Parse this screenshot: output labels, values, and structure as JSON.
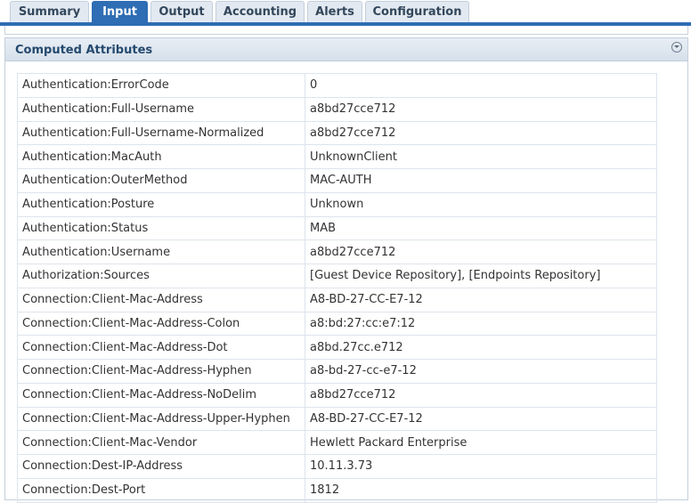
{
  "tabs": [
    {
      "label": "Summary",
      "active": false
    },
    {
      "label": "Input",
      "active": true
    },
    {
      "label": "Output",
      "active": false
    },
    {
      "label": "Accounting",
      "active": false
    },
    {
      "label": "Alerts",
      "active": false
    },
    {
      "label": "Configuration",
      "active": false
    }
  ],
  "panel": {
    "title": "Computed Attributes",
    "rows": [
      {
        "key": "Authentication:ErrorCode",
        "value": "0"
      },
      {
        "key": "Authentication:Full-Username",
        "value": "a8bd27cce712"
      },
      {
        "key": "Authentication:Full-Username-Normalized",
        "value": "a8bd27cce712"
      },
      {
        "key": "Authentication:MacAuth",
        "value": "UnknownClient"
      },
      {
        "key": "Authentication:OuterMethod",
        "value": "MAC-AUTH"
      },
      {
        "key": "Authentication:Posture",
        "value": "Unknown"
      },
      {
        "key": "Authentication:Status",
        "value": "MAB"
      },
      {
        "key": "Authentication:Username",
        "value": "a8bd27cce712"
      },
      {
        "key": "Authorization:Sources",
        "value": "[Guest Device Repository], [Endpoints Repository]"
      },
      {
        "key": "Connection:Client-Mac-Address",
        "value": "A8-BD-27-CC-E7-12"
      },
      {
        "key": "Connection:Client-Mac-Address-Colon",
        "value": "a8:bd:27:cc:e7:12"
      },
      {
        "key": "Connection:Client-Mac-Address-Dot",
        "value": "a8bd.27cc.e712"
      },
      {
        "key": "Connection:Client-Mac-Address-Hyphen",
        "value": "a8-bd-27-cc-e7-12"
      },
      {
        "key": "Connection:Client-Mac-Address-NoDelim",
        "value": "a8bd27cce712"
      },
      {
        "key": "Connection:Client-Mac-Address-Upper-Hyphen",
        "value": "A8-BD-27-CC-E7-12"
      },
      {
        "key": "Connection:Client-Mac-Vendor",
        "value": "Hewlett Packard Enterprise"
      },
      {
        "key": "Connection:Dest-IP-Address",
        "value": "10.11.3.73"
      },
      {
        "key": "Connection:Dest-Port",
        "value": "1812"
      }
    ]
  },
  "colors": {
    "accent": "#2f6db4",
    "header_text": "#24496e",
    "tab_bg": "#e2e9f1"
  },
  "icons": {
    "collapse": "collapse-circle-chevron-icon"
  }
}
